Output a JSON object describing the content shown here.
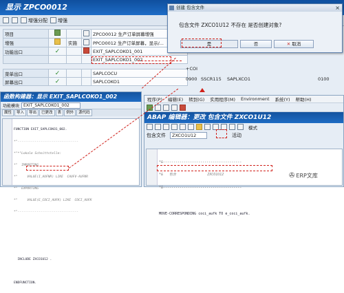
{
  "project": {
    "title": "显示 ZPCO0012",
    "toolbar": {
      "btn1": "增强分配",
      "btn2": "增强"
    },
    "rows": [
      {
        "label": "项目",
        "check": "",
        "small": "",
        "value": "ZPCO0012 生产订单屏幕增强"
      },
      {
        "label": "增强",
        "check": "",
        "small": "实施",
        "value": "PPCO0012 生产订单屏幕，显示/..."
      },
      {
        "label": "功能出口",
        "check": "✓",
        "small": "",
        "value": "EXIT_SAPLCOKO1_001"
      },
      {
        "label": "",
        "check": "",
        "small": "",
        "value": "EXIT_SAPLCOKO1_002"
      },
      {
        "label": "菜单出口",
        "check": "✓",
        "small": "",
        "value": "SAPLCOCU"
      },
      {
        "label": "屏幕出口",
        "check": "✓",
        "small": "",
        "value": "SAPLCOKO1"
      }
    ],
    "extra_col": {
      "coi": "+COI",
      "n0900": "0900",
      "scr": "SSCR115",
      "xc01": "SAPLXCO1",
      "n0100": "0100"
    }
  },
  "dialog": {
    "title": "创建 包含文件",
    "message": "包含文件  ZXCO1U12  不存在 是否创建对象?",
    "yes": "是",
    "no": "否",
    "cancel": "取消"
  },
  "function_builder": {
    "title": "函数构建器：显示 EXIT_SAPLCOKO1_002",
    "module_label": "功能模块",
    "module_value": "EXIT_SAPLCOKO1_002",
    "tabs": [
      "属性",
      "导入",
      "导出",
      "已更改",
      "表",
      "例外",
      "源代码"
    ],
    "code_lines": [
      "FUNCTION EXIT_SAPLCOKO1_002.",
      "*\"--------------------------------",
      "*\"*\"Lokale Schnittstelle:",
      "*\"  IMPORTING",
      "*\"     VALUE(I_AUFNR) LIKE  CAUFV-AUFNR",
      "*\"  EXPORTING",
      "*\"     VALUE(E_COCI_AUFK) LIKE  COCI_AUFK",
      "*\"--------------------------------",
      "",
      "",
      "",
      "  INCLUDE ZXCO1U12 .",
      "",
      "ENDFUNCTION."
    ]
  },
  "abap_editor": {
    "menu": [
      "程序(P)",
      "编辑(E)",
      "转到(G)",
      "实用程序(M)",
      "Environment",
      "系统(Y)",
      "帮助(H)"
    ],
    "title": "ABAP 编辑器：更改 包含文件 ZXCO1U12",
    "toolbar2_label": "模式",
    "include_label": "包含文件",
    "include_value": "ZXCO1U12",
    "status": "活动",
    "code_lines": [
      "*&--------------------------------------",
      "*&   包含               ZXCO1U12",
      "*&--------------------------------------",
      "",
      "MOVE-CORRESPONDING coci_aufk TO e_coci_aufk."
    ]
  },
  "watermark": {
    "text": "ERP文库"
  },
  "colors": {
    "title_blue": "#14539f",
    "highlight_red": "#d0201a",
    "check_green": "#2e8b2e"
  }
}
